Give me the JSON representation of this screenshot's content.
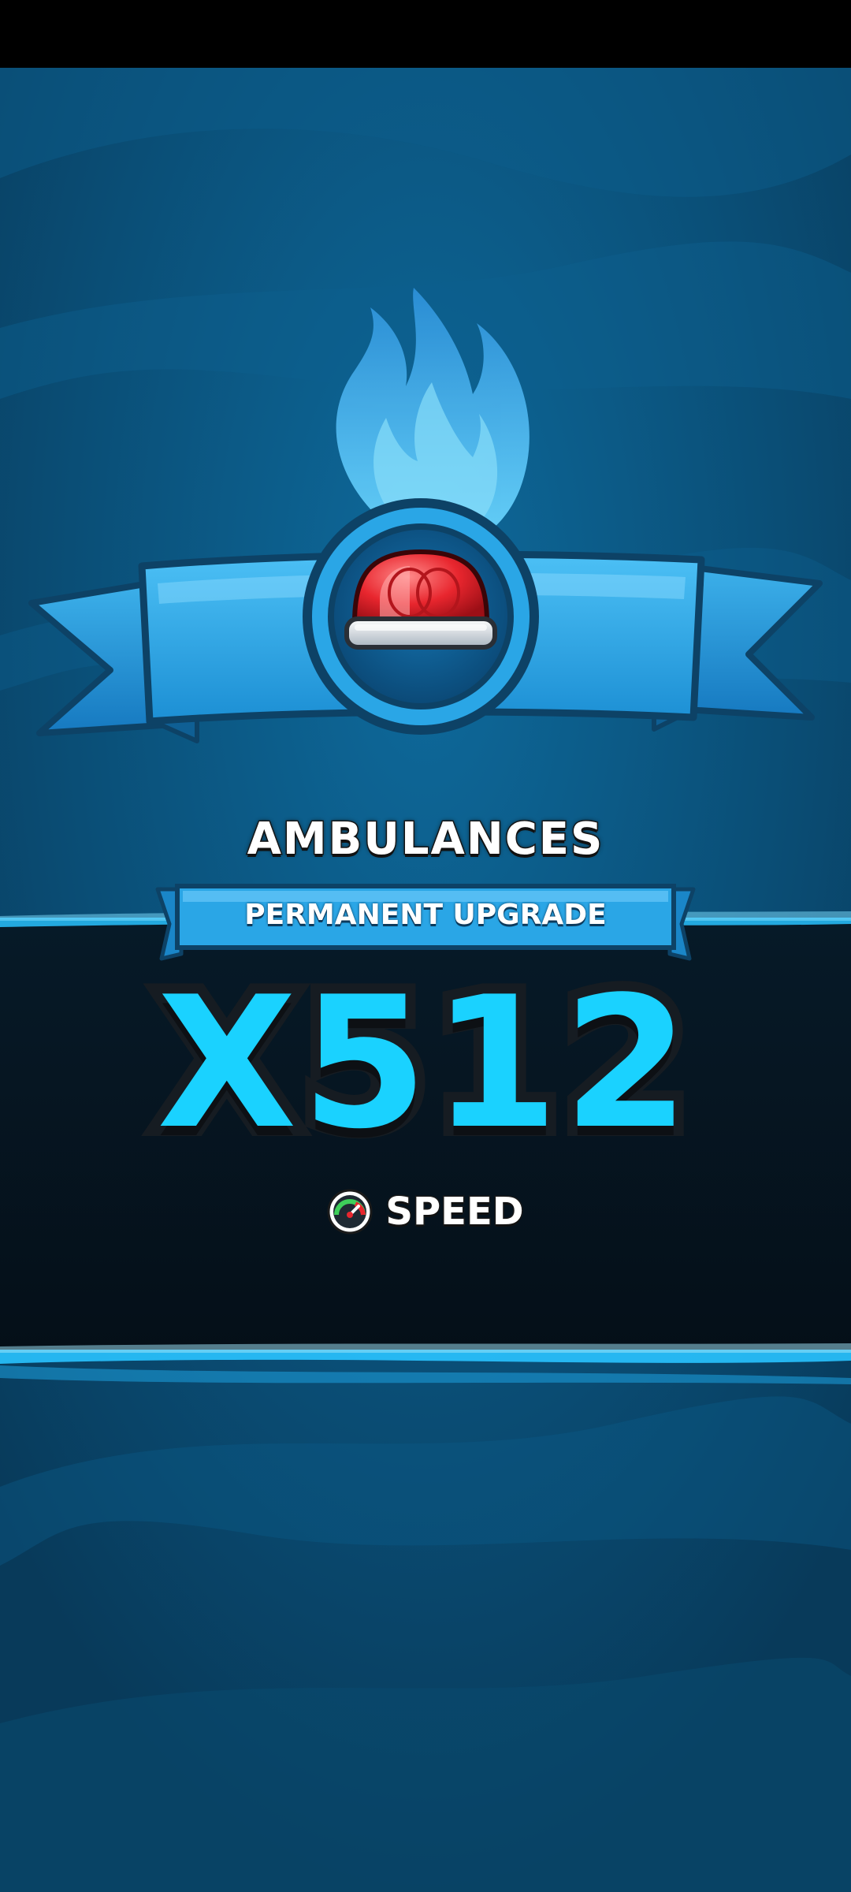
{
  "upgrade": {
    "name": "AMBULANCES",
    "banner": "PERMANENT UPGRADE",
    "multiplier": "X512",
    "stat": "SPEED"
  },
  "icons": {
    "badge": "siren-icon",
    "stat": "speedometer-icon"
  },
  "colors": {
    "background": "#0b4f78",
    "ribbon": "#2aa6e6",
    "multiplier": "#1ad2ff",
    "siren": "#e8262e"
  }
}
